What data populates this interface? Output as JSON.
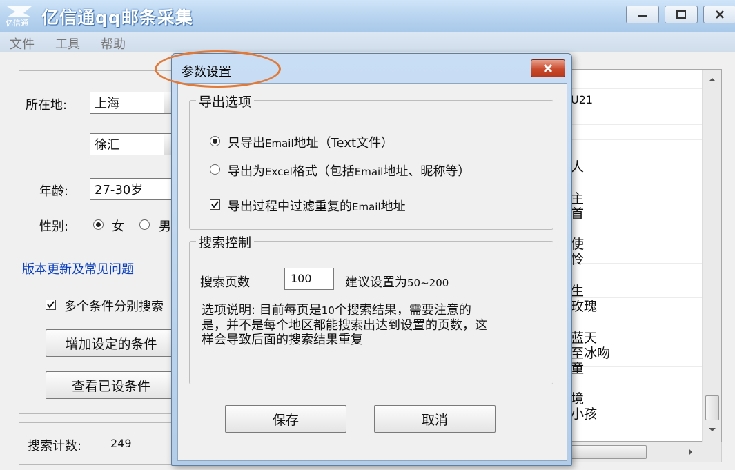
{
  "window": {
    "title": "亿信通qq邮条采集",
    "icon_name": "app-logo-icon",
    "icon_text": "亿信通",
    "controls": [
      "minimize-icon",
      "maximize-icon",
      "close-icon"
    ]
  },
  "menu": {
    "items": [
      "文件",
      "工具",
      "帮助"
    ]
  },
  "left_panel": {
    "location_label": "所在地:",
    "city": "上海",
    "district": "徐汇",
    "age_label": "年龄:",
    "age": "27-30岁",
    "gender_label": "性别:",
    "gender_female": "女",
    "gender_male": "男",
    "gender_selected": "女",
    "update_link": "版本更新及常见问题",
    "multi_condition": "多个条件分别搜索",
    "add_condition_button": "增加设定的条件",
    "view_condition_button": "查看已设条件",
    "search_count_label": "搜索计数:",
    "search_count": "249"
  },
  "result_list": {
    "rows": [
      "U21",
      "人",
      "主",
      "首",
      "使",
      "怜",
      "生",
      "玫瑰",
      "蓝天",
      "至冰吻",
      "童",
      "境",
      "小孩"
    ]
  },
  "dialog": {
    "title": "参数设置",
    "close_icon": "close-icon",
    "export_group": "导出选项",
    "export_option_1_pre": "只导出",
    "export_option_1_em": "Email",
    "export_option_1_post": "地址（",
    "export_option_1_text": "Text",
    "export_option_1_end": "文件）",
    "export_option_2_pre": "导出为",
    "export_option_2_em": "Excel",
    "export_option_2_mid": "格式（包括",
    "export_option_2_em2": "Email",
    "export_option_2_end": "地址、昵称等）",
    "export_selected": 1,
    "filter_dup_pre": "导出过程中过滤重复的",
    "filter_dup_em": "Email",
    "filter_dup_end": "地址",
    "filter_dup_checked": true,
    "search_group": "搜索控制",
    "pages_label": "搜索页数",
    "pages_value": "100",
    "pages_hint_pre": "建议设置为",
    "pages_hint_range": "50~200",
    "note_line1_pre": "选项说明: 目前每页是",
    "note_line1_num": "10",
    "note_line1_post": "个搜索结果，需要注意的",
    "note_line2": "是，并不是每个地区都能搜索出达到设置的页数，这",
    "note_line3": "样会导致后面的搜索结果重复",
    "save_button": "保存",
    "cancel_button": "取消"
  },
  "colors": {
    "link": "#0b3fbf",
    "title_bar": "#b7d3ef",
    "highlight_ring": "#e07a3a",
    "dialog_close": "#c94a2d"
  }
}
